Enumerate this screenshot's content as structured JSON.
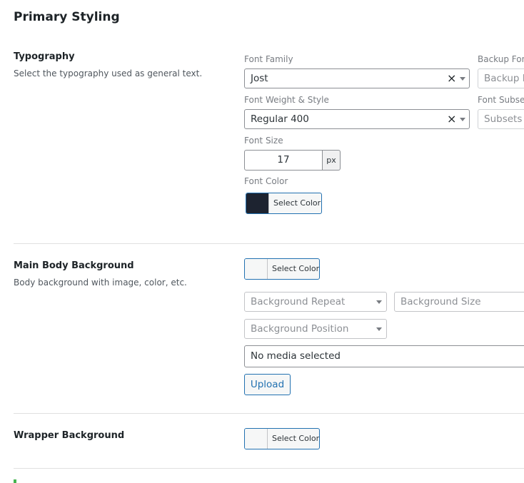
{
  "page": {
    "title": "Primary Styling"
  },
  "typography": {
    "title": "Typography",
    "description": "Select the typography used as general text.",
    "font_family": {
      "label": "Font Family",
      "value": "Jost"
    },
    "backup_font": {
      "label": "Backup Font",
      "placeholder": "Backup F"
    },
    "font_weight": {
      "label": "Font Weight & Style",
      "value": "Regular 400"
    },
    "font_subsets": {
      "label": "Font Subsets",
      "placeholder": "Subsets"
    },
    "font_size": {
      "label": "Font Size",
      "value": "17",
      "unit": "px"
    },
    "font_color": {
      "label": "Font Color",
      "button_label": "Select Color",
      "swatch_color": "#1d2330"
    }
  },
  "main_body_background": {
    "title": "Main Body Background",
    "description": "Body background with image, color, etc.",
    "color": {
      "button_label": "Select Color",
      "swatch_color": "#f6f7f7"
    },
    "background_repeat": {
      "placeholder": "Background Repeat"
    },
    "background_size": {
      "placeholder": "Background Size"
    },
    "background_position": {
      "placeholder": "Background Position"
    },
    "media": {
      "value": "No media selected"
    },
    "upload_label": "Upload"
  },
  "wrapper_background": {
    "title": "Wrapper Background",
    "color": {
      "button_label": "Select Color",
      "swatch_color": "#f6f7f7"
    }
  },
  "icons": {
    "clear": "×",
    "dropdown": "chevron-down-icon"
  },
  "colors": {
    "accent": "#2271b1",
    "success_marker": "#46b450"
  }
}
